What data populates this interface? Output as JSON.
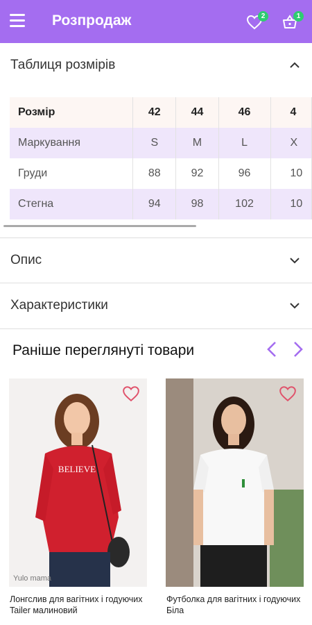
{
  "appbar": {
    "title": "Розпродаж",
    "favorites_count": "2",
    "cart_count": "1"
  },
  "size_table": {
    "title": "Таблиця розмірів",
    "header": {
      "label": "Розмір",
      "cols": [
        "42",
        "44",
        "46",
        "4"
      ]
    },
    "rows": [
      {
        "label": "Маркування",
        "cols": [
          "S",
          "M",
          "L",
          "X"
        ]
      },
      {
        "label": "Груди",
        "cols": [
          "88",
          "92",
          "96",
          "10"
        ]
      },
      {
        "label": "Стегна",
        "cols": [
          "94",
          "98",
          "102",
          "10"
        ]
      }
    ]
  },
  "sections": {
    "description": "Опис",
    "characteristics": "Характеристики"
  },
  "recently_viewed": {
    "title": "Раніше переглянуті товари",
    "products": [
      {
        "name": "Лонгслив для вагітних і годуючих Tailer малиновий",
        "watermark": "Yulo mama",
        "accent": "#d0202e"
      },
      {
        "name": "Футболка для вагітних і годуючих Біла",
        "accent": "#ffffff"
      }
    ]
  },
  "colors": {
    "primary": "#a46df0",
    "badge": "#2ecc71",
    "heart": "#e0526b"
  }
}
